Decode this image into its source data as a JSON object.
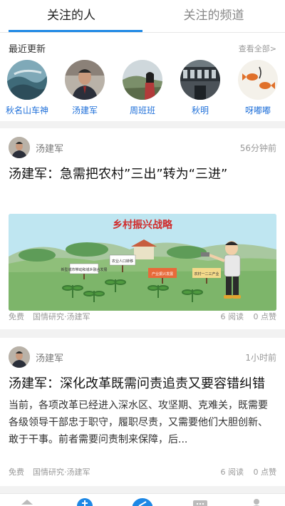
{
  "tabs": [
    "关注的人",
    "关注的频道"
  ],
  "recent": {
    "title": "最近更新",
    "see_all": "查看全部>",
    "people": [
      {
        "name": "秋名山车神",
        "icon": "coast-photo-avatar"
      },
      {
        "name": "汤建军",
        "icon": "man-in-suit-avatar"
      },
      {
        "name": "周班班",
        "icon": "person-outdoor-avatar"
      },
      {
        "name": "秋明",
        "icon": "building-photo-avatar"
      },
      {
        "name": "呀嘟嘟",
        "icon": "goldfish-drawing-avatar"
      }
    ]
  },
  "articles": [
    {
      "author": "汤建军",
      "time": "56分钟前",
      "title": "汤建军：急需把农村”三出”转为“三进”",
      "image_caption": "乡村振兴战略",
      "sign_labels": [
        "新型城市带动和城乡融合发展",
        "农业人口转移",
        "产业振兴发展",
        "农村一二三产业"
      ],
      "tag1": "免费",
      "tag2": "国情研究·汤建军",
      "reads": "6 阅读",
      "likes": "0 点赞"
    },
    {
      "author": "汤建军",
      "time": "1小时前",
      "title": "汤建军：深化改革既需问责追责又要容错纠错",
      "excerpt": "当前，各项改革已经进入深水区、攻坚期、克难关，既需要各级领导干部忠于职守，履职尽责，又需要他们大胆创新、敢于干事。前者需要问责制来保障，后...",
      "tag1": "免费",
      "tag2": "国情研究·汤建军",
      "reads": "6 阅读",
      "likes": "0 点赞"
    }
  ],
  "bottom_nav": [
    "home-icon",
    "add-icon",
    "center-icon",
    "message-icon",
    "profile-icon"
  ],
  "colors": {
    "accent": "#1e88e5",
    "link": "#1e6fd9"
  }
}
